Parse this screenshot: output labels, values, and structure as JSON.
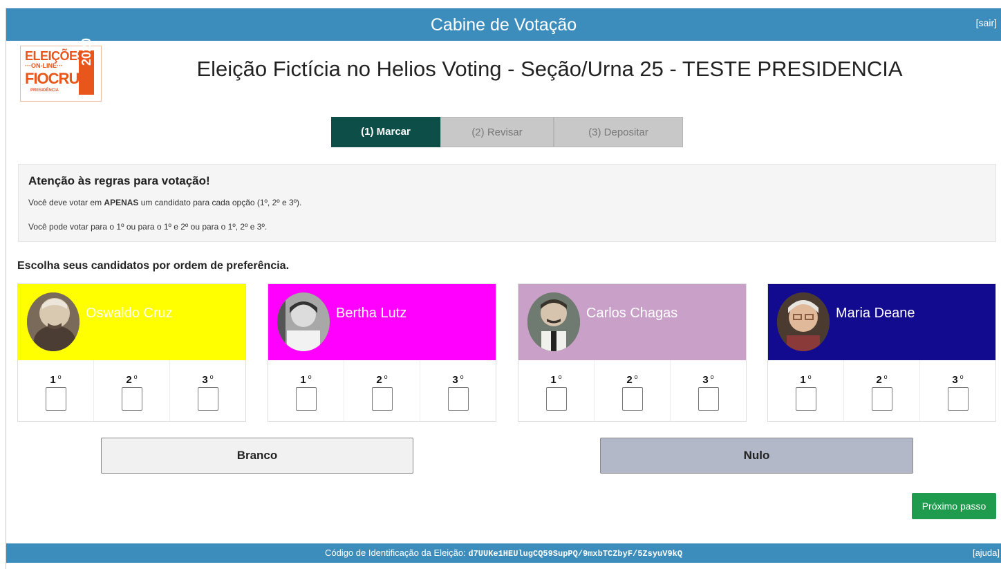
{
  "header": {
    "title": "Cabine de Votação",
    "sair_label": "[sair]"
  },
  "logo": {
    "line1": "ELEIÇÕES",
    "line2": "···ON-LINE···",
    "line3": "FIOCRUZ",
    "line4": "PRESIDÊNCIA",
    "year": "2020"
  },
  "election": {
    "title": "Eleição Fictícia no Helios Voting - Seção/Urna 25 - TESTE PRESIDENCIA"
  },
  "steps": [
    {
      "label": "(1) Marcar",
      "active": true
    },
    {
      "label": "(2) Revisar",
      "active": false
    },
    {
      "label": "(3) Depositar",
      "active": false
    }
  ],
  "rules": {
    "title": "Atenção às regras para votação!",
    "line1_prefix": "Você deve votar em ",
    "line1_bold": "APENAS",
    "line1_suffix": " um candidato para cada opção (1º, 2º e 3º).",
    "line2": "Você pode votar para o 1º ou para o 1º e 2º ou para o 1º, 2º e 3º."
  },
  "instruction": "Escolha seus candidatos por ordem de preferência.",
  "rank_labels": [
    "1",
    "2",
    "3"
  ],
  "rank_suffix": "o",
  "candidates": [
    {
      "name": "Oswaldo Cruz",
      "bg_color": "#ffff00",
      "text_color": "#ffffff",
      "photo": "oswaldo-cruz-portrait"
    },
    {
      "name": "Bertha Lutz",
      "bg_color": "#ff00ff",
      "text_color": "#ffffff",
      "photo": "bertha-lutz-portrait"
    },
    {
      "name": "Carlos Chagas",
      "bg_color": "#c8a0c8",
      "text_color": "#ffffff",
      "photo": "carlos-chagas-portrait"
    },
    {
      "name": "Maria Deane",
      "bg_color": "#120a8f",
      "text_color": "#ffffff",
      "photo": "maria-deane-portrait"
    }
  ],
  "buttons": {
    "branco": "Branco",
    "nulo": "Nulo",
    "next": "Próximo passo",
    "branco_color": "#f1f1f1",
    "nulo_color": "#b3b8c8",
    "next_color": "#1e9b4c"
  },
  "footer": {
    "code_label": "Código de Identificação da Eleição:",
    "code_value": "d7UUKe1HEUlugCQ59SupPQ/9mxbTCZbyF/5ZsyuV9kQ",
    "help_label": "[ajuda]"
  }
}
